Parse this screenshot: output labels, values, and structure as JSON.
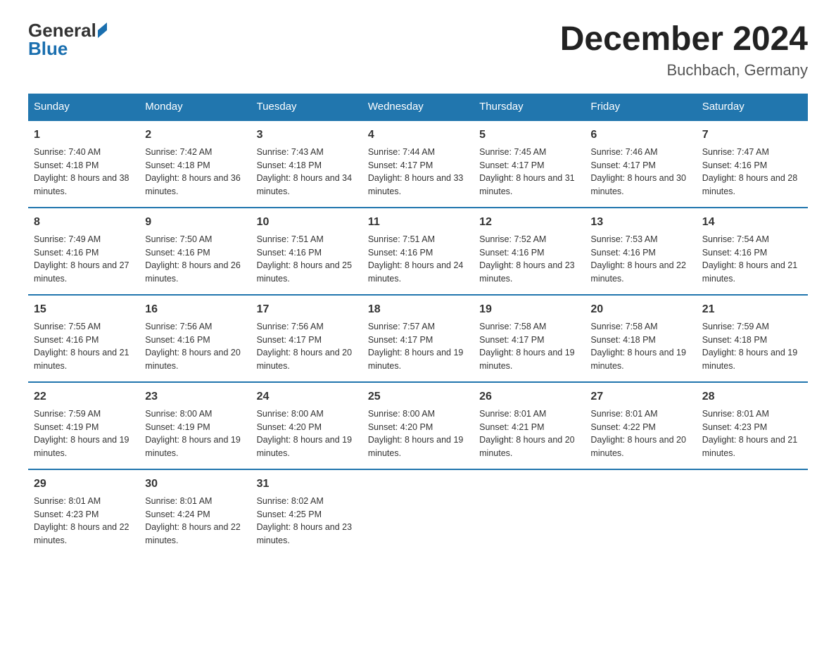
{
  "logo": {
    "general": "General",
    "blue": "Blue"
  },
  "title": {
    "month": "December 2024",
    "location": "Buchbach, Germany"
  },
  "headers": [
    "Sunday",
    "Monday",
    "Tuesday",
    "Wednesday",
    "Thursday",
    "Friday",
    "Saturday"
  ],
  "weeks": [
    [
      {
        "day": "1",
        "sunrise": "7:40 AM",
        "sunset": "4:18 PM",
        "daylight": "8 hours and 38 minutes."
      },
      {
        "day": "2",
        "sunrise": "7:42 AM",
        "sunset": "4:18 PM",
        "daylight": "8 hours and 36 minutes."
      },
      {
        "day": "3",
        "sunrise": "7:43 AM",
        "sunset": "4:18 PM",
        "daylight": "8 hours and 34 minutes."
      },
      {
        "day": "4",
        "sunrise": "7:44 AM",
        "sunset": "4:17 PM",
        "daylight": "8 hours and 33 minutes."
      },
      {
        "day": "5",
        "sunrise": "7:45 AM",
        "sunset": "4:17 PM",
        "daylight": "8 hours and 31 minutes."
      },
      {
        "day": "6",
        "sunrise": "7:46 AM",
        "sunset": "4:17 PM",
        "daylight": "8 hours and 30 minutes."
      },
      {
        "day": "7",
        "sunrise": "7:47 AM",
        "sunset": "4:16 PM",
        "daylight": "8 hours and 28 minutes."
      }
    ],
    [
      {
        "day": "8",
        "sunrise": "7:49 AM",
        "sunset": "4:16 PM",
        "daylight": "8 hours and 27 minutes."
      },
      {
        "day": "9",
        "sunrise": "7:50 AM",
        "sunset": "4:16 PM",
        "daylight": "8 hours and 26 minutes."
      },
      {
        "day": "10",
        "sunrise": "7:51 AM",
        "sunset": "4:16 PM",
        "daylight": "8 hours and 25 minutes."
      },
      {
        "day": "11",
        "sunrise": "7:51 AM",
        "sunset": "4:16 PM",
        "daylight": "8 hours and 24 minutes."
      },
      {
        "day": "12",
        "sunrise": "7:52 AM",
        "sunset": "4:16 PM",
        "daylight": "8 hours and 23 minutes."
      },
      {
        "day": "13",
        "sunrise": "7:53 AM",
        "sunset": "4:16 PM",
        "daylight": "8 hours and 22 minutes."
      },
      {
        "day": "14",
        "sunrise": "7:54 AM",
        "sunset": "4:16 PM",
        "daylight": "8 hours and 21 minutes."
      }
    ],
    [
      {
        "day": "15",
        "sunrise": "7:55 AM",
        "sunset": "4:16 PM",
        "daylight": "8 hours and 21 minutes."
      },
      {
        "day": "16",
        "sunrise": "7:56 AM",
        "sunset": "4:16 PM",
        "daylight": "8 hours and 20 minutes."
      },
      {
        "day": "17",
        "sunrise": "7:56 AM",
        "sunset": "4:17 PM",
        "daylight": "8 hours and 20 minutes."
      },
      {
        "day": "18",
        "sunrise": "7:57 AM",
        "sunset": "4:17 PM",
        "daylight": "8 hours and 19 minutes."
      },
      {
        "day": "19",
        "sunrise": "7:58 AM",
        "sunset": "4:17 PM",
        "daylight": "8 hours and 19 minutes."
      },
      {
        "day": "20",
        "sunrise": "7:58 AM",
        "sunset": "4:18 PM",
        "daylight": "8 hours and 19 minutes."
      },
      {
        "day": "21",
        "sunrise": "7:59 AM",
        "sunset": "4:18 PM",
        "daylight": "8 hours and 19 minutes."
      }
    ],
    [
      {
        "day": "22",
        "sunrise": "7:59 AM",
        "sunset": "4:19 PM",
        "daylight": "8 hours and 19 minutes."
      },
      {
        "day": "23",
        "sunrise": "8:00 AM",
        "sunset": "4:19 PM",
        "daylight": "8 hours and 19 minutes."
      },
      {
        "day": "24",
        "sunrise": "8:00 AM",
        "sunset": "4:20 PM",
        "daylight": "8 hours and 19 minutes."
      },
      {
        "day": "25",
        "sunrise": "8:00 AM",
        "sunset": "4:20 PM",
        "daylight": "8 hours and 19 minutes."
      },
      {
        "day": "26",
        "sunrise": "8:01 AM",
        "sunset": "4:21 PM",
        "daylight": "8 hours and 20 minutes."
      },
      {
        "day": "27",
        "sunrise": "8:01 AM",
        "sunset": "4:22 PM",
        "daylight": "8 hours and 20 minutes."
      },
      {
        "day": "28",
        "sunrise": "8:01 AM",
        "sunset": "4:23 PM",
        "daylight": "8 hours and 21 minutes."
      }
    ],
    [
      {
        "day": "29",
        "sunrise": "8:01 AM",
        "sunset": "4:23 PM",
        "daylight": "8 hours and 22 minutes."
      },
      {
        "day": "30",
        "sunrise": "8:01 AM",
        "sunset": "4:24 PM",
        "daylight": "8 hours and 22 minutes."
      },
      {
        "day": "31",
        "sunrise": "8:02 AM",
        "sunset": "4:25 PM",
        "daylight": "8 hours and 23 minutes."
      },
      null,
      null,
      null,
      null
    ]
  ]
}
